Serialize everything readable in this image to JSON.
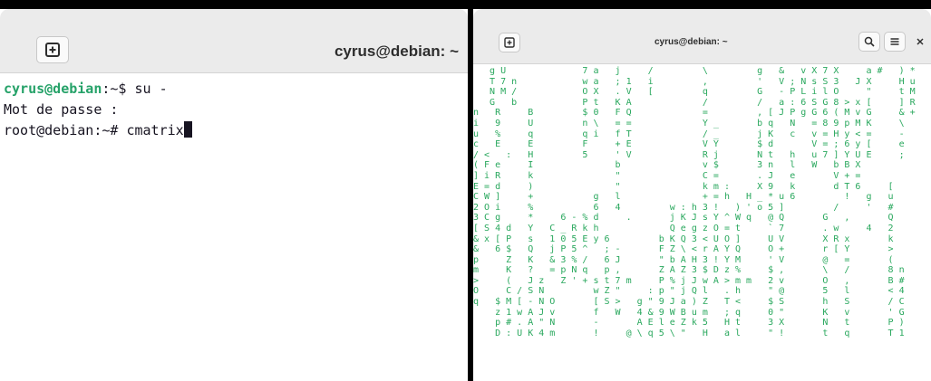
{
  "left_window": {
    "title": "cyrus@debian: ~",
    "new_tab_icon": "new-tab-icon",
    "lines": [
      {
        "user": "cyrus@debian",
        "rest": ":~$ su -"
      },
      {
        "text": "Mot de passe :"
      },
      {
        "text": "root@debian:~# cmatrix"
      }
    ]
  },
  "right_window": {
    "title": "cyrus@debian: ~",
    "buttons": {
      "new_tab": "new-tab-icon",
      "search": "search-icon",
      "menu": "menu-icon",
      "close": "close-icon"
    },
    "matrix_rows": [
      "   g U              7 a   j     /         \\         g   &   v X 7 X     a #   ) *",
      "   T 7 n            w a   ; 1   i         ,         '   V ; N s S 3   J X     H u",
      "   N M /            O X   . V   [         q         G   - P L i l O     \"     t M",
      "   G   b            P t   K A             /         /   a : 6 S G 8 > x [     ] R",
      "n   R     B         $ 0   F Q             =         , [ J P g G 6 ( M v G     & +",
      "i   9     U         n \\   = =             Y _       b q   N   = 8 9 p M K     \\",
      "u   %     q         q i   f T             / _       j K   c   v = H y < =     -",
      "c   E     E         F     + E             V Y       $ d       V = ; 6 y [     e",
      "/ <   :   H         5     ' V             R j       N t   h   u 7 ] Y U E     ;",
      "( F e     I               b               v $       3 n   l   W   b B X",
      "] i R     k               \"               C =       . J   e       V + =",
      "E = d     )               \"               k m :     X 9   k       d T 6     [",
      "C W ]     +           g   l               + = h   H _ * u 6         !   g   u",
      "2 O i     %           6   4         w : h 3 !   ) ' o 5 ]         /     '   #",
      "3 C g     *     6 - % d     .       j K J s Y ^ W q   @ Q       G   ,       Q",
      "[ S 4 d   Y   C _ R k h             Q e g z O = t     ` 7       . w     4   2",
      "& x [ P   s   1 0 5 E y 6         b K Q 3 < U O ]     U V       X R x       k",
      "&   6 $   Q   j P 5 ^   ; -       F Z \\ < r A Y Q     O +       r [ Y       >",
      "p     Z   K   & 3 % /   6 J       \" b A H 3 ! Y M     ' V       @   =       (",
      "m     K   ?   = p N q   p ,       Z A Z 3 $ D z %     $ ,       \\   /       8 n",
      ">     (   J z   Z ' + s t 7 m     P % j J w A > m m   2 v       O   ,       B #",
      "O     C / S N         w Z \"     : p \" j Q l   . h     \" @       5   l       < 4",
      "q   $ M [ - N O       [ S >   g \" 9 J a ) Z   T <     $ S       h   S       / C",
      "    z 1 w A J v       f   W   4 & 9 W B u m   ; q     0 \"       K   v       ' G",
      "    p # . A \" N       -       A E l e Z k 5   H t     3 X       N   t       P )",
      "    D : U K 4 m       !     @ \\ q 5 \\ \"   H   a l     \" !       t   q       T 1"
    ]
  }
}
